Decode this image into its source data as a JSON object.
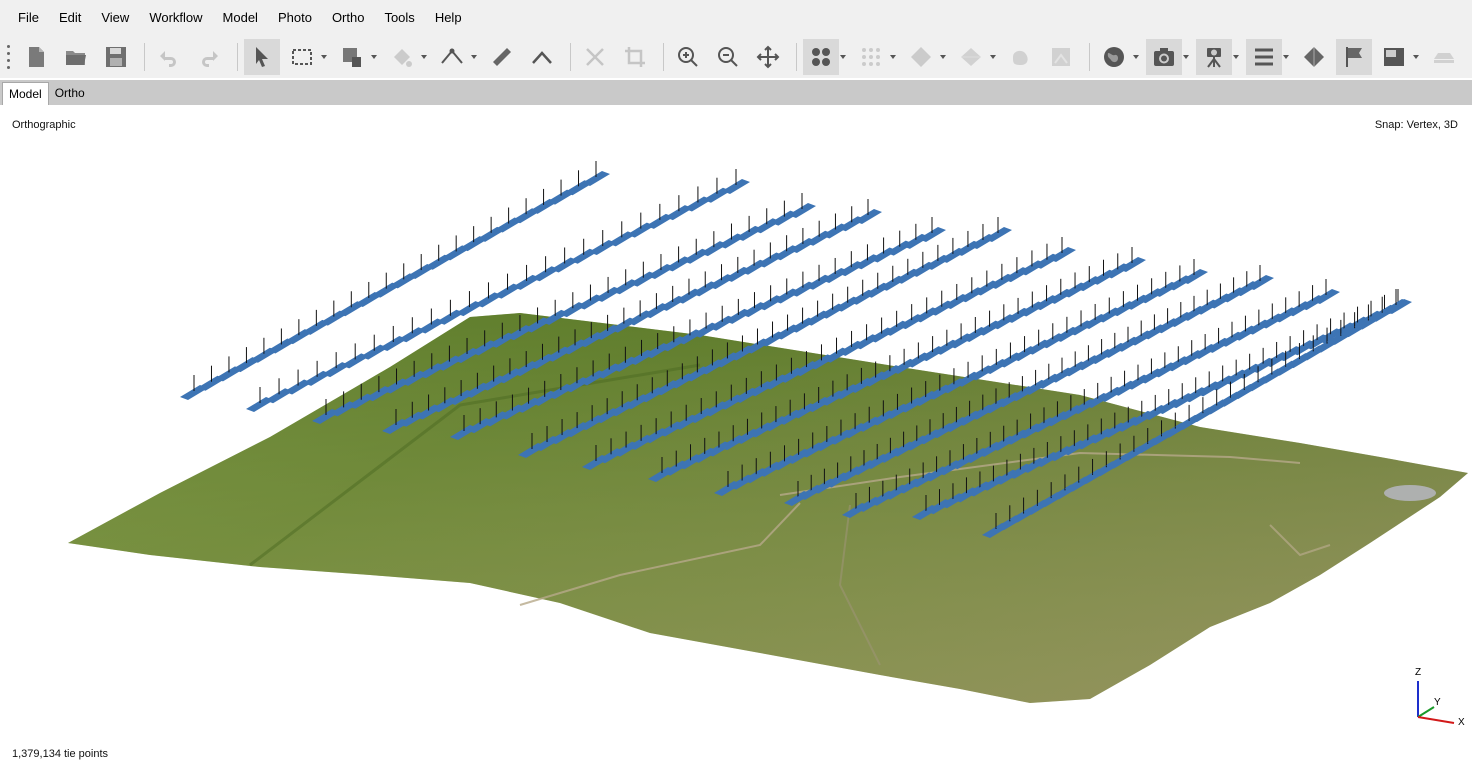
{
  "menu": {
    "file": "File",
    "edit": "Edit",
    "view": "View",
    "workflow": "Workflow",
    "model": "Model",
    "photo": "Photo",
    "ortho": "Ortho",
    "tools": "Tools",
    "help": "Help"
  },
  "tabs": {
    "model": "Model",
    "ortho": "Ortho"
  },
  "viewport": {
    "projection": "Orthographic",
    "snap": "Snap: Vertex, 3D",
    "status": "1,379,134 tie points",
    "axes": {
      "x": "X",
      "y": "Y",
      "z": "Z"
    }
  },
  "colors": {
    "camera_plane": "#3d74b4",
    "terrain": "#6e8b3a",
    "menu_bg": "#f0f0f0",
    "tab_bar": "#c9c9c9"
  }
}
